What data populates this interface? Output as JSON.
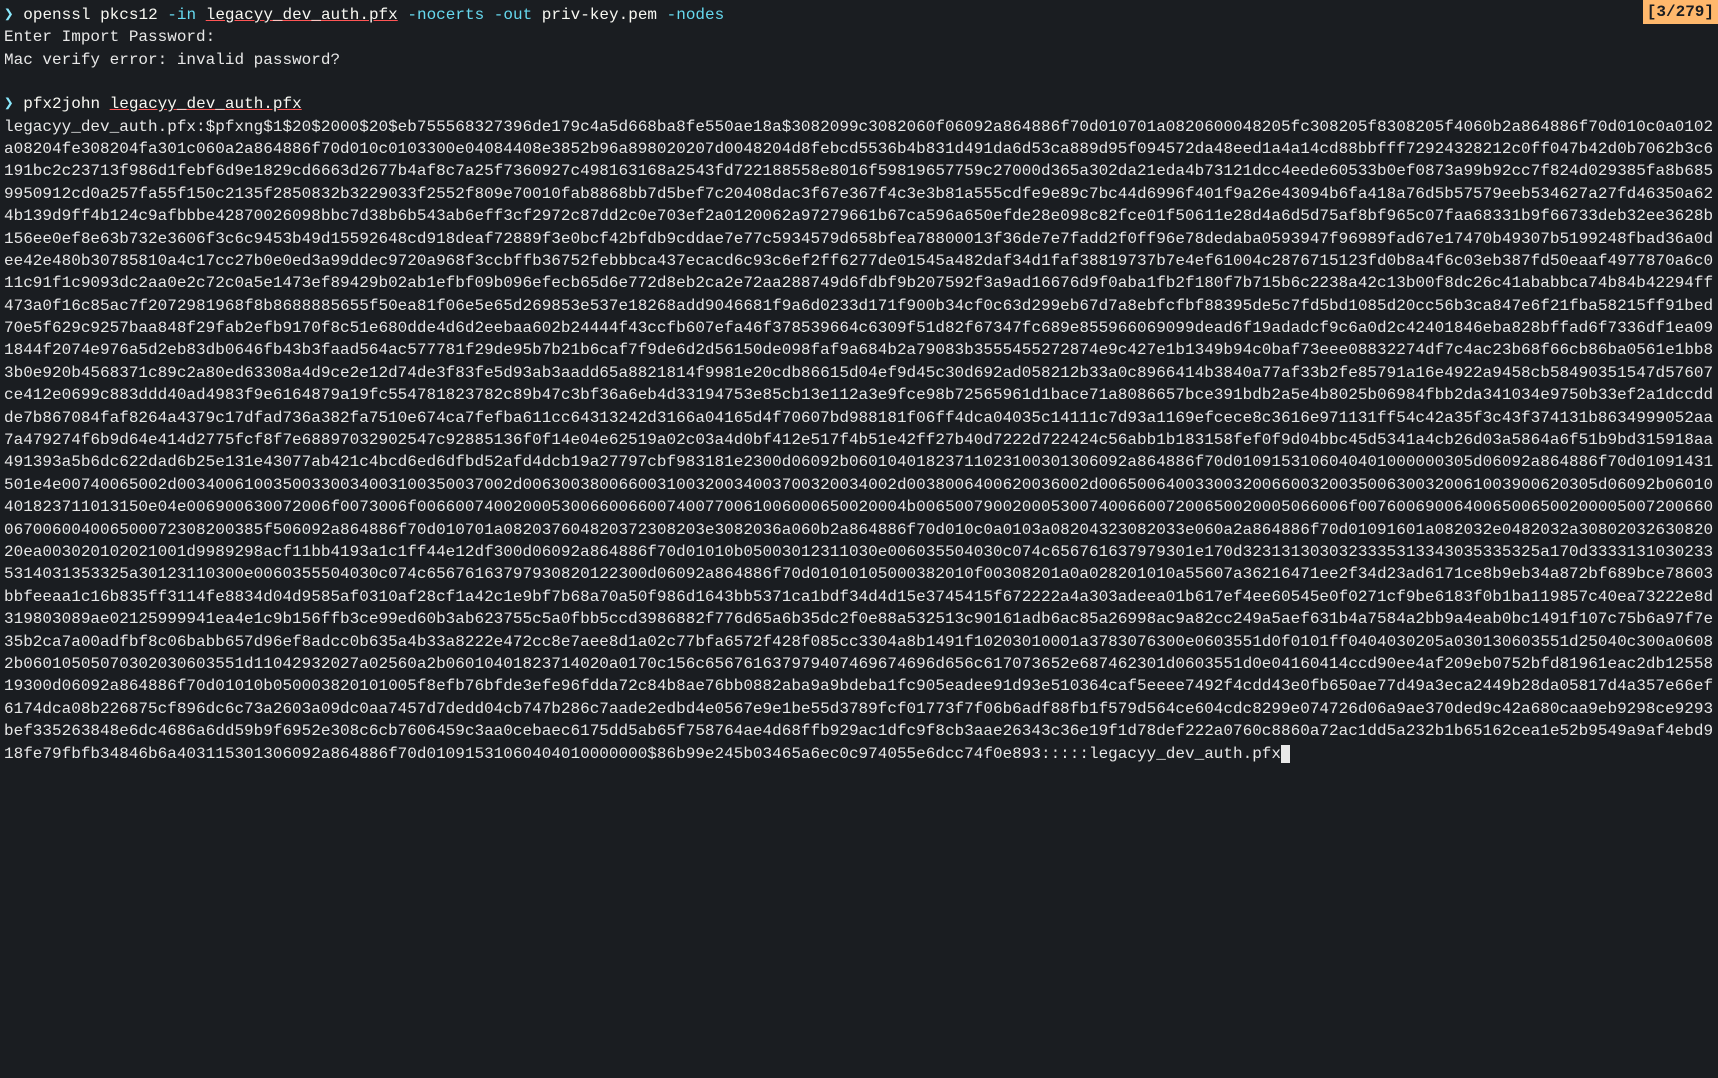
{
  "search_counter": "[3/279]",
  "cmd1": {
    "prompt": "❯",
    "tool": "openssl",
    "subcommand": "pkcs12",
    "opt_in": "-in",
    "file_in": "legacyy_dev_auth.pfx",
    "opt_nocerts": "-nocerts",
    "opt_out": "-out",
    "file_out": "priv-key.pem",
    "opt_nodes": "-nodes"
  },
  "output1": {
    "line1": "Enter Import Password:",
    "line2": "Mac verify error: invalid password?"
  },
  "cmd2": {
    "prompt": "❯",
    "tool": "pfx2john",
    "file": "legacyy_dev_auth.pfx"
  },
  "hash_output": "legacyy_dev_auth.pfx:$pfxng$1$20$2000$20$eb755568327396de179c4a5d668ba8fe550ae18a$3082099c3082060f06092a864886f70d010701a0820600048205fc308205f8308205f4060b2a864886f70d010c0a0102a08204fe308204fa301c060a2a864886f70d010c0103300e04084408e3852b96a898020207d0048204d8febcd5536b4b831d491da6d53ca889d95f094572da48eed1a4a14cd88bbfff72924328212c0ff047b42d0b7062b3c6191bc2c23713f986d1febf6d9e1829cd6663d2677b4af8c7a25f7360927c498163168a2543fd722188558e8016f59819657759c27000d365a302da21eda4b73121dcc4eede60533b0ef0873a99b92cc7f824d029385fa8b6859950912cd0a257fa55f150c2135f2850832b3229033f2552f809e70010fab8868bb7d5bef7c20408dac3f67e367f4c3e3b81a555cdfe9e89c7bc44d6996f401f9a26e43094b6fa418a76d5b57579eeb534627a27fd46350a624b139d9ff4b124c9afbbbe42870026098bbc7d38b6b543ab6eff3cf2972c87dd2c0e703ef2a0120062a97279661b67ca596a650efde28e098c82fce01f50611e28d4a6d5d75af8bf965c07faa68331b9f66733deb32ee3628b156ee0ef8e63b732e3606f3c6c9453b49d15592648cd918deaf72889f3e0bcf42bfdb9cddae7e77c5934579d658bfea78800013f36de7e7fadd2f0ff96e78dedaba0593947f96989fad67e17470b49307b5199248fbad36a0dee42e480b30785810a4c17cc27b0e0ed3a99ddec9720a968f3ccbffb36752febbbca437ecacd6c93c6ef2ff6277de01545a482daf34d1faf38819737b7e4ef61004c2876715123fd0b8a4f6c03eb387fd50eaaf4977870a6c011c91f1c9093dc2aa0e2c72c0a5e1473ef89429b02ab1efbf09b096efecb65d6e772d8eb2ca2e72aa288749d6fdbf9b207592f3a9ad16676d9f0aba1fb2f180f7b715b6c2238a42c13b00f8dc26c41ababbca74b84b42294ff473a0f16c85ac7f2072981968f8b8688885655f50ea81f06e5e65d269853e537e18268add9046681f9a6d0233d171f900b34cf0c63d299eb67d7a8ebfcfbf88395de5c7fd5bd1085d20cc56b3ca847e6f21fba58215ff91bed70e5f629c9257baa848f29fab2efb9170f8c51e680dde4d6d2eebaa602b24444f43ccfb607efa46f378539664c6309f51d82f67347fc689e855966069099dead6f19adadcf9c6a0d2c42401846eba828bffad6f7336df1ea091844f2074e976a5d2eb83db0646fb43b3faad564ac577781f29de95b7b21b6caf7f9de6d2d56150de098faf9a684b2a79083b3555455272874e9c427e1b1349b94c0baf73eee08832274df7c4ac23b68f66cb86ba0561e1bb83b0e920b4568371c89c2a80ed63308a4d9ce2e12d74de3f83fe5d93ab3aadd65a8821814f9981e20cdb86615d04ef9d45c30d692ad058212b33a0c8966414b3840a77af33b2fe85791a16e4922a9458cb58490351547d57607ce412e0699c883ddd40ad4983f9e6164879a19fc554781823782c89b47c3bf36a6eb4d33194753e85cb13e112a3e9fce98b72565961d1bace71a8086657bce391bdb2a5e4b8025b06984fbb2da341034e9750b33ef2a1dccddde7b867084faf8264a4379c17dfad736a382fa7510e674ca7fefba611cc64313242d3166a04165d4f70607bd988181f06ff4dca04035c14111c7d93a1169efcece8c3616e971131ff54c42a35f3c43f374131b8634999052aa7a479274f6b9d64e414d2775fcf8f7e68897032902547c92885136f0f14e04e62519a02c03a4d0bf412e517f4b51e42ff27b40d7222d722424c56abb1b183158fef0f9d04bbc45d5341a4cb26d03a5864a6f51b9bd315918aa491393a5b6dc622dad6b25e131e43077ab421c4bcd6ed6dfbd52afd4dcb19a27797cbf983181e2300d06092b06010401823711023100301306092a864886f70d0109153106040401000000305d06092a864886f70d01091431501e4e00740065002d00340061003500330034003100350037002d006300380066003100320034003700320034002d0038006400620036002d0065006400330032006600320035006300320061003900620305d06092b06010401823711013150e04e006900630072006f0073006f006600740020005300660066007400770061006000650020004b006500790020005300740066007200650020005066006f0076006900640065006500200005007200660067006004006500072308200385f506092a864886f70d010701a082037604820372308203e3082036a060b2a864886f70d010c0a0103a08204323082033e060a2a864886f70d01091601a082032e0482032a3080203263082020ea003020102021001d9989298acf11bb4193a1c1ff44e12df300d06092a864886f70d01010b05003012311030e006035504030c074c656761637979301e170d3231313030323335313343035335325a170d33331310302335314031353325a30123110300e0060355504030c074c65676163797930820122300d06092a864886f70d01010105000382010f00308201a0a028201010a55607a36216471ee2f34d23ad6171ce8b9eb34a872bf689bce78603bbfeeaa1c16b835ff3114fe8834d04d9585af0310af28cf1a42c1e9bf7b68a70a50f986d1643bb5371ca1bdf34d4d15e3745415f672222a4a303adeea01b617ef4ee60545e0f0271cf9be6183f0b1ba119857c40ea73222e8d319803089ae02125999941ea4e1c9b156ffb3ce99ed60b3ab623755c5a0fbb5ccd3986882f776d65a6b35dc2f0e88a532513c90161adb6ac85a26998ac9a82cc249a5aef631b4a7584a2bb9a4eab0bc1491f107c75b6a97f7e35b2ca7a00adfbf8c06babb657d96ef8adcc0b635a4b33a8222e472cc8e7aee8d1a02c77bfa6572f428f085cc3304a8b1491f10203010001a3783076300e0603551d0f0101ff0404030205a030130603551d25040c300a06082b06010505070302030603551d11042932027a02560a2b06010401823714020a0170c156c656761637979407469674696d656c617073652e687462301d0603551d0e04160414ccd90ee4af209eb0752bfd81961eac2db1255819300d06092a864886f70d01010b050003820101005f8efb76bfde3efe96fdda72c84b8ae76bb0882aba9a9bdeba1fc905eadee91d93e510364caf5eeee7492f4cdd43e0fb650ae77d49a3eca2449b28da05817d4a357e66ef6174dca08b226875cf896dc6c73a2603a09dc0aa7457d7dedd04cb747b286c7aade2edbd4e0567e9e1be55d3789fcf01773f7f06b6adf88fb1f579d564ce604cdc8299e074726d06a9ae370ded9c42a680caa9eb9298ce9293bef335263848e6dc4686a6dd59b9f6952e308c6cb7606459c3aa0cebaec6175dd5ab65f758764ae4d68ffb929ac1dfc9f8cb3aae26343c36e19f1d78def222a0760c8860a72ac1dd5a232b1b65162cea1e52b9549a9af4ebd918fe79fbfb34846b6a403115301306092a864886f70d01091531060404010000000$86b99e245b03465a6ec0c974055e6dcc74f0e893:::::legacyy_dev_auth.pfx"
}
